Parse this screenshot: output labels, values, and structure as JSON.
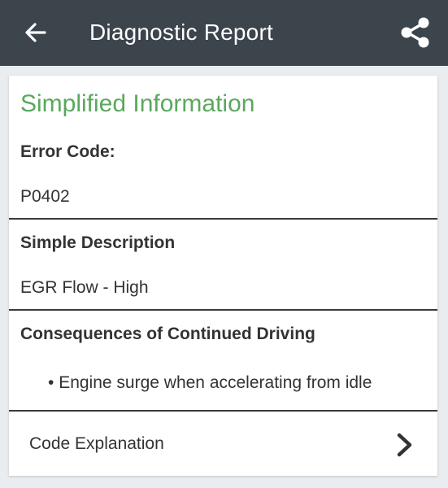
{
  "header": {
    "title": "Diagnostic Report",
    "back_icon": "arrow-left-icon",
    "share_icon": "share-icon",
    "background_color": "#3c444c"
  },
  "report": {
    "section_title": "Simplified Information",
    "accent_color": "#5aa85e",
    "error_code_label": "Error Code:",
    "error_code_value": "P0402",
    "description_label": "Simple Description",
    "description_value": "EGR Flow - High",
    "consequences_label": "Consequences of Continued Driving",
    "consequences": [
      "Engine surge when accelerating from idle"
    ],
    "code_explanation_label": "Code Explanation",
    "code_explanation_icon": "chevron-right-icon"
  }
}
